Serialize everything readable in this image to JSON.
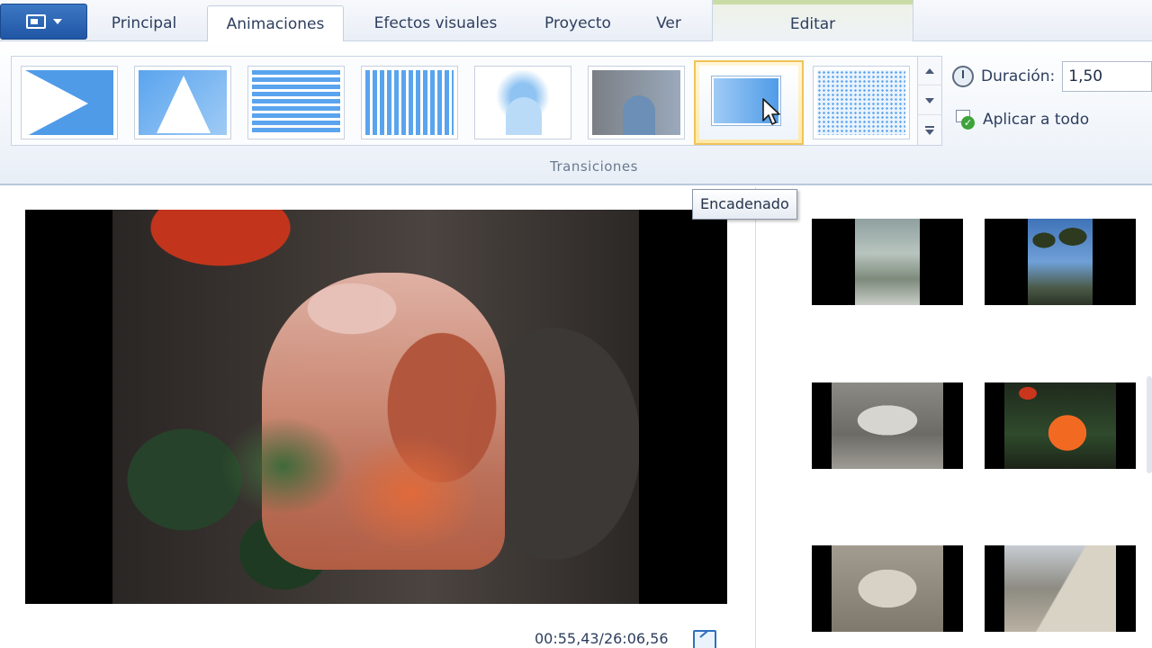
{
  "ribbon": {
    "tabs": [
      {
        "label": "Principal"
      },
      {
        "label": "Animaciones"
      },
      {
        "label": "Efectos visuales"
      },
      {
        "label": "Proyecto"
      },
      {
        "label": "Ver"
      }
    ],
    "active_tab": "Animaciones",
    "contextual_tab": {
      "label": "Editar"
    },
    "transitions_group": {
      "label": "Transiciones",
      "selected_tooltip": "Encadenado"
    },
    "duration": {
      "label": "Duración:",
      "value": "1,50"
    },
    "apply_all_label": "Aplicar a todo"
  },
  "preview": {
    "timecode": "00:55,43/26:06,56"
  },
  "colors": {
    "accent": "#2f6fbf",
    "selected_highlight": "#f0c35a",
    "app_button": "#1f56a5"
  },
  "icons": {
    "app_menu": "app-menu-icon",
    "duration": "stopwatch-icon",
    "apply_all": "apply-check-icon",
    "fullscreen": "fullscreen-icon",
    "cursor": "mouse-pointer-icon"
  }
}
